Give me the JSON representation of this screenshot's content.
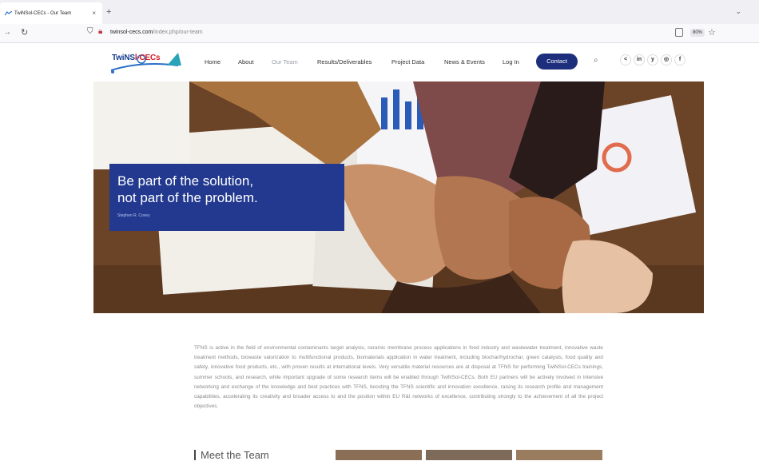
{
  "browser": {
    "tab_title": "TwiNSol-CECs - Our Team",
    "tab_close": "×",
    "new_tab": "+",
    "tabs_menu": "⌄",
    "url_domain": "twinsol-cecs.com",
    "url_path": "/index.php/our-team",
    "zoom": "80%"
  },
  "header": {
    "logo_text_a": "TwiNS",
    "logo_text_b": "l-CECs",
    "nav": [
      "Home",
      "About",
      "Our Team",
      "Results/Deliverables",
      "Project Data",
      "News & Events",
      "Log In"
    ],
    "contact": "Contact",
    "social": [
      "<",
      "in",
      "y",
      "◎",
      "f"
    ]
  },
  "hero": {
    "quote_line1": "Be part of the solution,",
    "quote_line2": "not part of the problem.",
    "author": "Stephen R. Covey"
  },
  "about": {
    "text": "TFNS is active in the field of environmental contaminants target analysis, ceramic membrane process applications in food industry and wastewater treatment, innovative waste treatment methods, biowaste valorization to multifunctional products, biomaterials application in water treatment, including biochar/hydrochar, green catalysts, food quality and safety, innovative food products, etc., with proven results at international levels. Very versatile material resources are at disposal at TFNS for performing TwiNSol-CECs trainings, summer schools, and research, while important upgrade of some research items will be enabled through TwiNSol-CECs. Both EU partners will be actively involved in intensive networking and exchange of the knowledge and best practices with TFNS, boosting the TFNS scientific and innovation excellence, raising its research profile and management capabilities, accelerating its creativity and broader access to and the position within EU R&I networks of excellence, contributing strongly to the achievement of all the project objectives."
  },
  "team": {
    "heading": "Meet the Team"
  },
  "colors": {
    "brand_blue": "#1d2f7c",
    "quote_blue": "#22398f",
    "logo_red": "#d0202a"
  }
}
